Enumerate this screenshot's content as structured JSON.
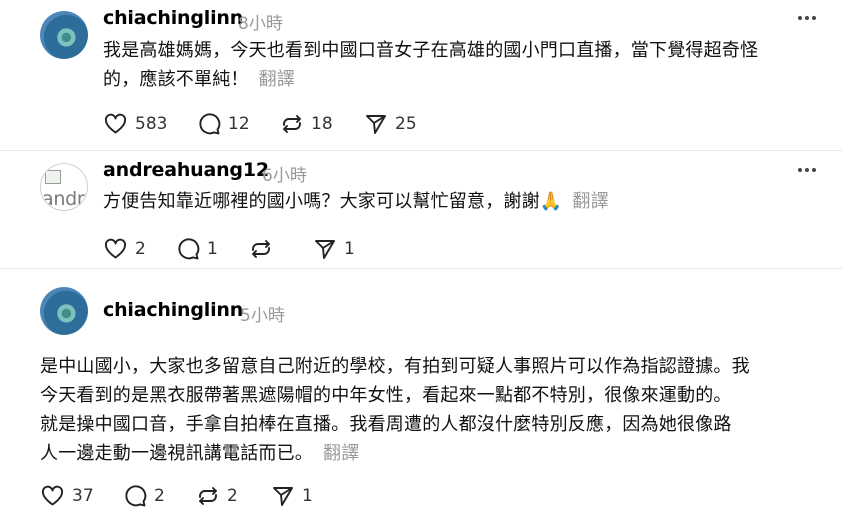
{
  "posts": [
    {
      "username": "chiachinglinn",
      "time": "8小時",
      "content_lines": [
        "我是高雄媽媽，今天也看到中國口音女子在高雄的國小門口直播，當下覺得超奇怪",
        "的，應該不單純！"
      ],
      "translate": "翻譯",
      "likes": "583",
      "comments": "12",
      "reposts": "18",
      "shares": "25"
    },
    {
      "username": "andreahuang12",
      "time": "6小時",
      "avatar_alt": "andr",
      "content_lines": [
        "方便告知靠近哪裡的國小嗎？大家可以幫忙留意，謝謝🙏"
      ],
      "translate": "翻譯",
      "likes": "2",
      "comments": "1",
      "reposts": "",
      "shares": "1"
    },
    {
      "username": "chiachinglinn",
      "time": "5小時",
      "content_lines": [
        "是中山國小，大家也多留意自己附近的學校，有拍到可疑人事照片可以作為指認證據。我",
        "今天看到的是黑衣服帶著黑遮陽帽的中年女性，看起來一點都不特別，很像來運動的。",
        "就是操中國口音，手拿自拍棒在直播。我看周遭的人都沒什麼特別反應，因為她很像路",
        "人一邊走動一邊視訊講電話而已。"
      ],
      "translate": "翻譯",
      "likes": "37",
      "comments": "2",
      "reposts": "2",
      "shares": "1"
    }
  ],
  "icons": {
    "like": "heart-icon",
    "comment": "comment-bubble-icon",
    "repost": "repost-icon",
    "share": "send-icon",
    "more": "more-dots-icon"
  }
}
